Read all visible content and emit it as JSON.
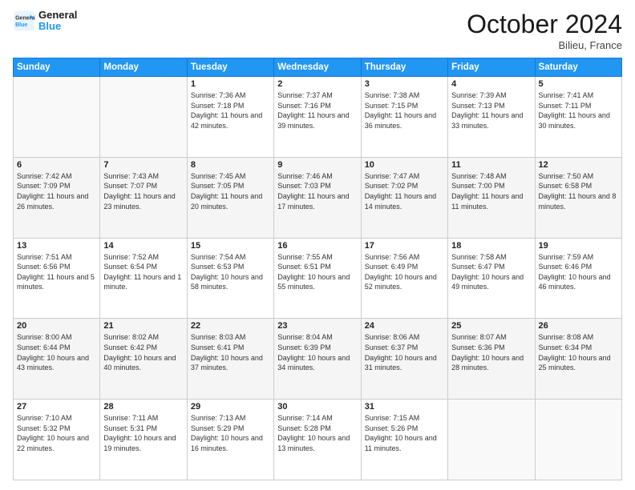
{
  "header": {
    "logo_line1": "General",
    "logo_line2": "Blue",
    "month_title": "October 2024",
    "location": "Bilieu, France"
  },
  "days_of_week": [
    "Sunday",
    "Monday",
    "Tuesday",
    "Wednesday",
    "Thursday",
    "Friday",
    "Saturday"
  ],
  "weeks": [
    [
      {
        "day": "",
        "info": ""
      },
      {
        "day": "",
        "info": ""
      },
      {
        "day": "1",
        "info": "Sunrise: 7:36 AM\nSunset: 7:18 PM\nDaylight: 11 hours and 42 minutes."
      },
      {
        "day": "2",
        "info": "Sunrise: 7:37 AM\nSunset: 7:16 PM\nDaylight: 11 hours and 39 minutes."
      },
      {
        "day": "3",
        "info": "Sunrise: 7:38 AM\nSunset: 7:15 PM\nDaylight: 11 hours and 36 minutes."
      },
      {
        "day": "4",
        "info": "Sunrise: 7:39 AM\nSunset: 7:13 PM\nDaylight: 11 hours and 33 minutes."
      },
      {
        "day": "5",
        "info": "Sunrise: 7:41 AM\nSunset: 7:11 PM\nDaylight: 11 hours and 30 minutes."
      }
    ],
    [
      {
        "day": "6",
        "info": "Sunrise: 7:42 AM\nSunset: 7:09 PM\nDaylight: 11 hours and 26 minutes."
      },
      {
        "day": "7",
        "info": "Sunrise: 7:43 AM\nSunset: 7:07 PM\nDaylight: 11 hours and 23 minutes."
      },
      {
        "day": "8",
        "info": "Sunrise: 7:45 AM\nSunset: 7:05 PM\nDaylight: 11 hours and 20 minutes."
      },
      {
        "day": "9",
        "info": "Sunrise: 7:46 AM\nSunset: 7:03 PM\nDaylight: 11 hours and 17 minutes."
      },
      {
        "day": "10",
        "info": "Sunrise: 7:47 AM\nSunset: 7:02 PM\nDaylight: 11 hours and 14 minutes."
      },
      {
        "day": "11",
        "info": "Sunrise: 7:48 AM\nSunset: 7:00 PM\nDaylight: 11 hours and 11 minutes."
      },
      {
        "day": "12",
        "info": "Sunrise: 7:50 AM\nSunset: 6:58 PM\nDaylight: 11 hours and 8 minutes."
      }
    ],
    [
      {
        "day": "13",
        "info": "Sunrise: 7:51 AM\nSunset: 6:56 PM\nDaylight: 11 hours and 5 minutes."
      },
      {
        "day": "14",
        "info": "Sunrise: 7:52 AM\nSunset: 6:54 PM\nDaylight: 11 hours and 1 minute."
      },
      {
        "day": "15",
        "info": "Sunrise: 7:54 AM\nSunset: 6:53 PM\nDaylight: 10 hours and 58 minutes."
      },
      {
        "day": "16",
        "info": "Sunrise: 7:55 AM\nSunset: 6:51 PM\nDaylight: 10 hours and 55 minutes."
      },
      {
        "day": "17",
        "info": "Sunrise: 7:56 AM\nSunset: 6:49 PM\nDaylight: 10 hours and 52 minutes."
      },
      {
        "day": "18",
        "info": "Sunrise: 7:58 AM\nSunset: 6:47 PM\nDaylight: 10 hours and 49 minutes."
      },
      {
        "day": "19",
        "info": "Sunrise: 7:59 AM\nSunset: 6:46 PM\nDaylight: 10 hours and 46 minutes."
      }
    ],
    [
      {
        "day": "20",
        "info": "Sunrise: 8:00 AM\nSunset: 6:44 PM\nDaylight: 10 hours and 43 minutes."
      },
      {
        "day": "21",
        "info": "Sunrise: 8:02 AM\nSunset: 6:42 PM\nDaylight: 10 hours and 40 minutes."
      },
      {
        "day": "22",
        "info": "Sunrise: 8:03 AM\nSunset: 6:41 PM\nDaylight: 10 hours and 37 minutes."
      },
      {
        "day": "23",
        "info": "Sunrise: 8:04 AM\nSunset: 6:39 PM\nDaylight: 10 hours and 34 minutes."
      },
      {
        "day": "24",
        "info": "Sunrise: 8:06 AM\nSunset: 6:37 PM\nDaylight: 10 hours and 31 minutes."
      },
      {
        "day": "25",
        "info": "Sunrise: 8:07 AM\nSunset: 6:36 PM\nDaylight: 10 hours and 28 minutes."
      },
      {
        "day": "26",
        "info": "Sunrise: 8:08 AM\nSunset: 6:34 PM\nDaylight: 10 hours and 25 minutes."
      }
    ],
    [
      {
        "day": "27",
        "info": "Sunrise: 7:10 AM\nSunset: 5:32 PM\nDaylight: 10 hours and 22 minutes."
      },
      {
        "day": "28",
        "info": "Sunrise: 7:11 AM\nSunset: 5:31 PM\nDaylight: 10 hours and 19 minutes."
      },
      {
        "day": "29",
        "info": "Sunrise: 7:13 AM\nSunset: 5:29 PM\nDaylight: 10 hours and 16 minutes."
      },
      {
        "day": "30",
        "info": "Sunrise: 7:14 AM\nSunset: 5:28 PM\nDaylight: 10 hours and 13 minutes."
      },
      {
        "day": "31",
        "info": "Sunrise: 7:15 AM\nSunset: 5:26 PM\nDaylight: 10 hours and 11 minutes."
      },
      {
        "day": "",
        "info": ""
      },
      {
        "day": "",
        "info": ""
      }
    ]
  ]
}
